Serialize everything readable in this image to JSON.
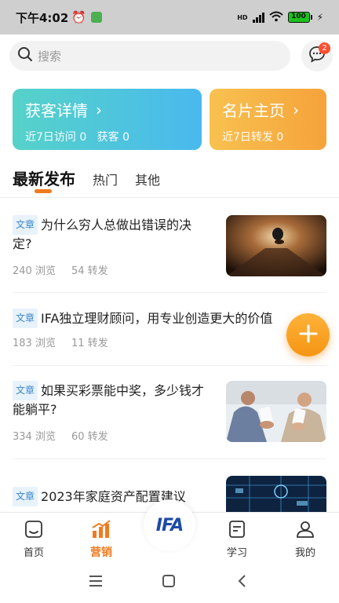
{
  "status_bar": {
    "time": "下午4:02",
    "battery": "100",
    "network": "HD"
  },
  "search": {
    "placeholder": "搜索"
  },
  "messages": {
    "badge_count": "2"
  },
  "cards": [
    {
      "title": "获客详情",
      "sub": "近7日访问 0   获客 0"
    },
    {
      "title": "名片主页",
      "sub": "近7日转发 0"
    }
  ],
  "tabs": [
    "最新发布",
    "热门",
    "其他"
  ],
  "articles": [
    {
      "tag": "文章",
      "title": "为什么穷人总做出错误的决定?",
      "views": "240 浏览",
      "shares": "54 转发"
    },
    {
      "tag": "文章",
      "title": "IFA独立理财顾问，用专业创造更大的价值",
      "views": "183 浏览",
      "shares": "11 转发"
    },
    {
      "tag": "文章",
      "title": "如果买彩票能中奖，多少钱才能躺平?",
      "views": "334 浏览",
      "shares": "60 转发"
    },
    {
      "tag": "文章",
      "title": "2023年家庭资产配置建议",
      "views": "",
      "shares": ""
    }
  ],
  "bottom_nav": {
    "home": "首页",
    "marketing": "营销",
    "center_logo": "IFA",
    "learn": "学习",
    "mine": "我的"
  },
  "colors": {
    "accent": "#f07a1e",
    "card_left": "#4fc6dc",
    "card_right": "#f6ab3d",
    "tag": "#3b86c8"
  }
}
